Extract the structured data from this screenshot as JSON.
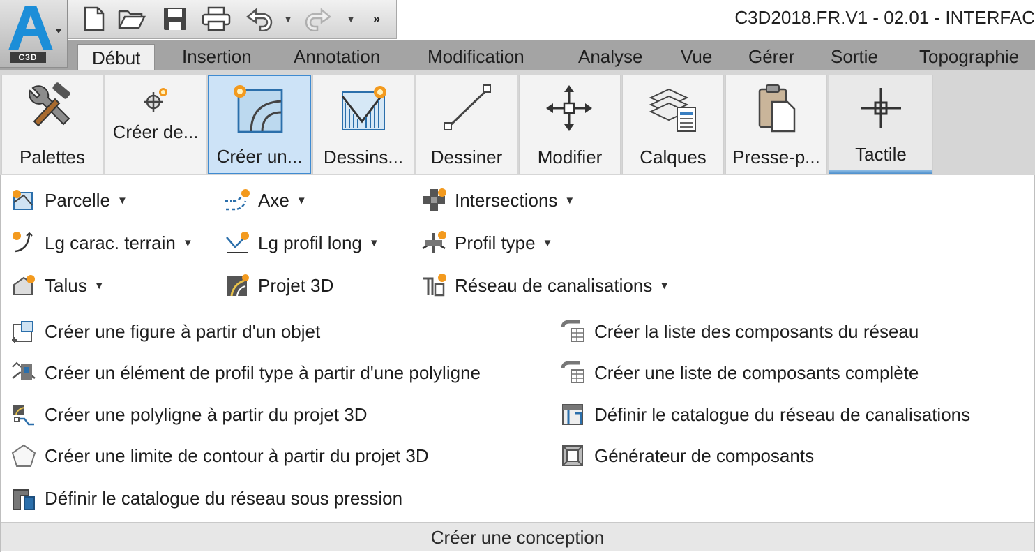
{
  "app": {
    "badge": "C3D",
    "window_title": "C3D2018.FR.V1 - 02.01 - INTERFAC"
  },
  "quick_access": {
    "icons": [
      "new-file-icon",
      "open-folder-icon",
      "save-icon",
      "print-icon",
      "undo-icon",
      "redo-icon",
      "more-icon"
    ]
  },
  "tabs": [
    {
      "label": "Début",
      "active": true
    },
    {
      "label": "Insertion"
    },
    {
      "label": "Annotation"
    },
    {
      "label": "Modification"
    },
    {
      "label": "Analyse"
    },
    {
      "label": "Vue"
    },
    {
      "label": "Gérer"
    },
    {
      "label": "Sortie"
    },
    {
      "label": "Topographie"
    }
  ],
  "ribbon_buttons": [
    {
      "label": "Palettes",
      "icon": "tools-icon"
    },
    {
      "label": "Créer de...",
      "icon": "crosshair-star-icon"
    },
    {
      "label": "Créer un...",
      "icon": "create-design-icon",
      "selected": true
    },
    {
      "label": "Dessins...",
      "icon": "profile-view-icon"
    },
    {
      "label": "Dessiner",
      "icon": "line-icon"
    },
    {
      "label": "Modifier",
      "icon": "move-icon"
    },
    {
      "label": "Calques",
      "icon": "layers-icon"
    },
    {
      "label": "Presse-p...",
      "icon": "clipboard-icon"
    },
    {
      "label": "Tactile",
      "icon": "touch-crosshair-icon"
    }
  ],
  "panel": {
    "title": "Créer une conception",
    "dropdown_rows": [
      [
        {
          "label": "Parcelle",
          "icon": "parcel-icon"
        },
        {
          "label": "Axe",
          "icon": "alignment-icon"
        },
        {
          "label": "Intersections",
          "icon": "intersection-icon"
        }
      ],
      [
        {
          "label": "Lg carac. terrain",
          "icon": "feature-line-icon"
        },
        {
          "label": "Lg profil long",
          "icon": "profile-icon"
        },
        {
          "label": "Profil type",
          "icon": "assembly-icon"
        }
      ],
      [
        {
          "label": "Talus",
          "icon": "grading-icon"
        },
        {
          "label": "Projet 3D",
          "icon": "corridor-icon",
          "no_arrow": true
        },
        {
          "label": "Réseau de canalisations",
          "icon": "pipe-network-icon"
        }
      ]
    ],
    "left_list": [
      {
        "label": "Créer une figure à partir d'un objet",
        "icon": "figure-from-object-icon"
      },
      {
        "label": "Créer un élément de profil type à partir d'une polyligne",
        "icon": "subassembly-from-polyline-icon"
      },
      {
        "label": "Créer une polyligne à partir du projet 3D",
        "icon": "polyline-from-corridor-icon"
      },
      {
        "label": "Créer une limite de contour à partir du projet 3D",
        "icon": "pentagon-icon"
      },
      {
        "label": "Définir le catalogue du réseau sous pression",
        "icon": "pressure-catalog-icon"
      }
    ],
    "right_list": [
      {
        "label": "Créer la liste des composants du réseau",
        "icon": "parts-list-icon"
      },
      {
        "label": "Créer une liste de composants complète",
        "icon": "full-parts-list-icon"
      },
      {
        "label": "Définir le catalogue du réseau de canalisations",
        "icon": "pipe-catalog-icon"
      },
      {
        "label": "Générateur de composants",
        "icon": "part-builder-icon"
      }
    ]
  }
}
